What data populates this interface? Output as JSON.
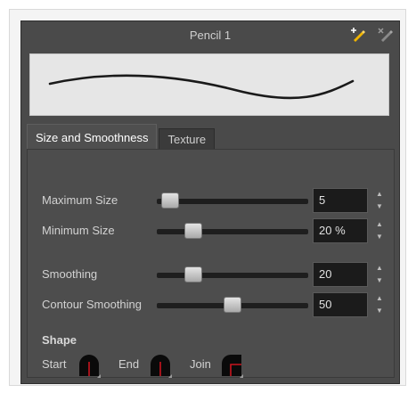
{
  "panel": {
    "title": "Pencil 1",
    "icons": [
      "add-pencil-icon",
      "delete-pencil-icon"
    ]
  },
  "tabs": [
    {
      "label": "Size and Smoothness",
      "active": true
    },
    {
      "label": "Texture",
      "active": false
    }
  ],
  "controls": [
    {
      "label": "Maximum Size",
      "value": "5",
      "slider_fraction": 0.08
    },
    {
      "label": "Minimum Size",
      "value": "20 %",
      "slider_fraction": 0.24
    },
    {
      "label": "Smoothing",
      "value": "20",
      "slider_fraction": 0.24
    },
    {
      "label": "Contour Smoothing",
      "value": "50",
      "slider_fraction": 0.5
    }
  ],
  "shape": {
    "title": "Shape",
    "start_label": "Start",
    "end_label": "End",
    "join_label": "Join"
  },
  "colors": {
    "panel_bg": "#4a4a4a",
    "preview_bg": "#e6e6e6",
    "accent_red": "#c8141e",
    "icon_yellow": "#f0b400"
  }
}
